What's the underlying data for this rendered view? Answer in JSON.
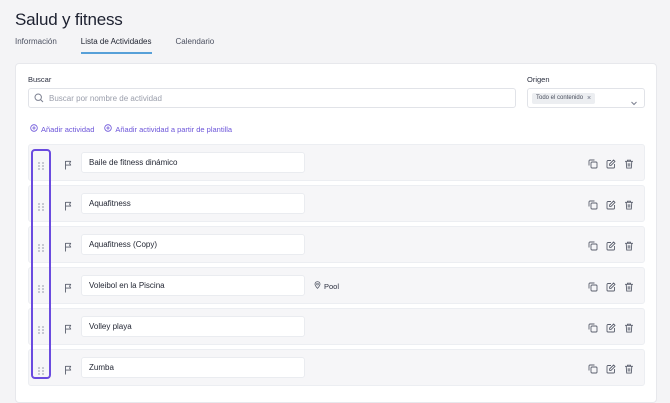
{
  "page": {
    "title": "Salud y fitness"
  },
  "tabs": [
    "Información",
    "Lista de Actividades",
    "Calendario"
  ],
  "filters": {
    "search_label": "Buscar",
    "search_placeholder": "Buscar por nombre de actividad",
    "origin_label": "Origen",
    "origin_chip": "Todo el contenido",
    "origin_chip_remove": "×"
  },
  "actions": {
    "add_activity": "Añadir actividad",
    "add_from_template": "Añadir actividad a partir de plantilla"
  },
  "activities": [
    {
      "name": "Baile de fitness dinámico",
      "location": ""
    },
    {
      "name": "Aquafitness",
      "location": ""
    },
    {
      "name": "Aquafitness (Copy)",
      "location": ""
    },
    {
      "name": "Voleibol en la Piscina",
      "location": "Pool"
    },
    {
      "name": "Volley playa",
      "location": ""
    },
    {
      "name": "Zumba",
      "location": ""
    }
  ],
  "colors": {
    "accent": "#6c55d9",
    "tab_underline": "#57a0d8",
    "drag_highlight": "#6a4bdf"
  },
  "icons": [
    "search-icon",
    "chevron-down-icon",
    "plus-circle-icon",
    "drag-handle-icon",
    "flag-icon",
    "location-pin-icon",
    "duplicate-icon",
    "edit-icon",
    "trash-icon"
  ]
}
